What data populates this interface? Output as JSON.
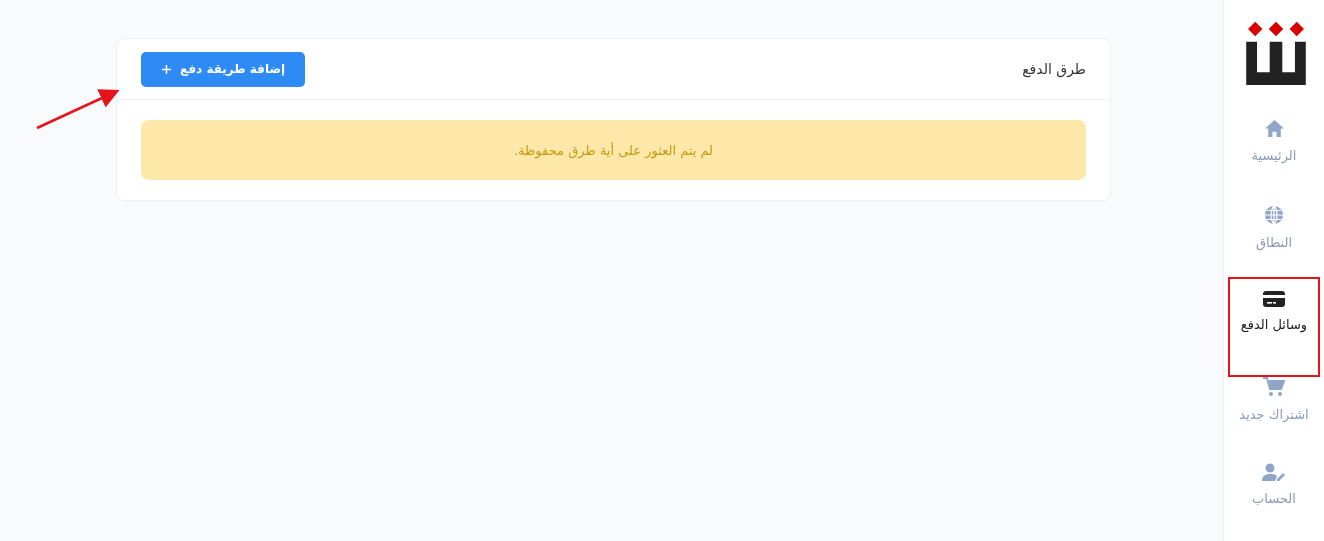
{
  "card": {
    "title": "طرق الدفع",
    "add_button": "إضافة طريقة دفع",
    "empty_message": "لم يتم العثور على أية طرق محفوظة."
  },
  "sidebar": {
    "items": [
      {
        "label": "الرئيسية",
        "kind": "home",
        "selected": false
      },
      {
        "label": "النطاق",
        "kind": "globe",
        "selected": false
      },
      {
        "label": "وسائل الدفع",
        "kind": "card",
        "selected": true
      },
      {
        "label": "اشتراك جديد",
        "kind": "cart",
        "selected": false
      },
      {
        "label": "الحساب",
        "kind": "user",
        "selected": false
      }
    ]
  }
}
